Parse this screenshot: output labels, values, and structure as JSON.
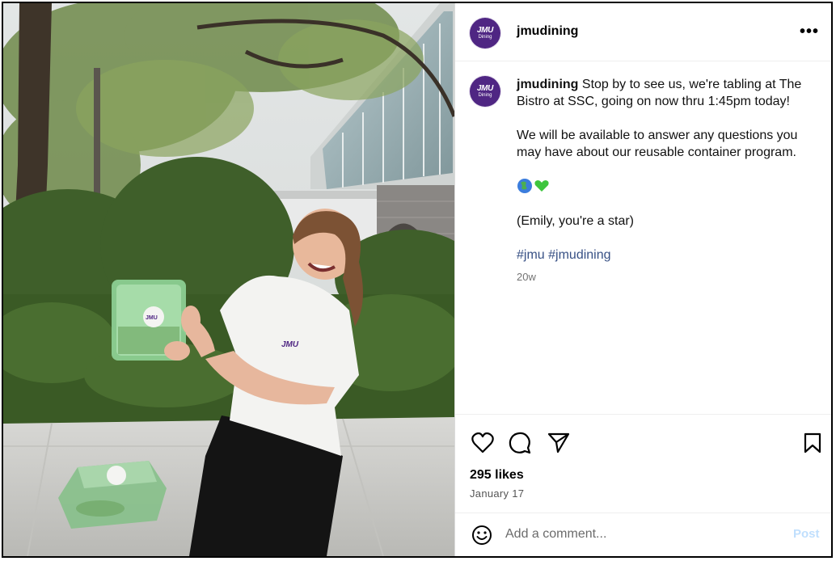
{
  "post": {
    "username": "jmudining",
    "more_options": "•••",
    "avatar": {
      "line1": "JMU",
      "line2": "Dining",
      "color": "#4f2683"
    },
    "caption": {
      "username": "jmudining",
      "text_intro": "Stop by to see us, we're tabling at The Bistro at SSC, going on now thru 1:45pm today!",
      "paragraph2": "We will be available to answer any questions you may have about our reusable container program.",
      "emojis": "🌎💚",
      "paragraph4": "(Emily, you're a star)",
      "hashtags": [
        "#jmu",
        "#jmudining"
      ],
      "time_ago": "20w"
    },
    "likes": "295 likes",
    "date": "January 17",
    "comment": {
      "placeholder": "Add a comment...",
      "post_label": "Post"
    },
    "image": {
      "description_icons": [
        "heart-icon",
        "comment-icon",
        "share-icon",
        "bookmark-icon",
        "emoji-icon"
      ],
      "box_label": "JMU",
      "shirt_text": "JMU"
    },
    "colors": {
      "link": "#385185",
      "post_disabled": "#c0dffd",
      "brand_purple": "#4f2683"
    }
  }
}
